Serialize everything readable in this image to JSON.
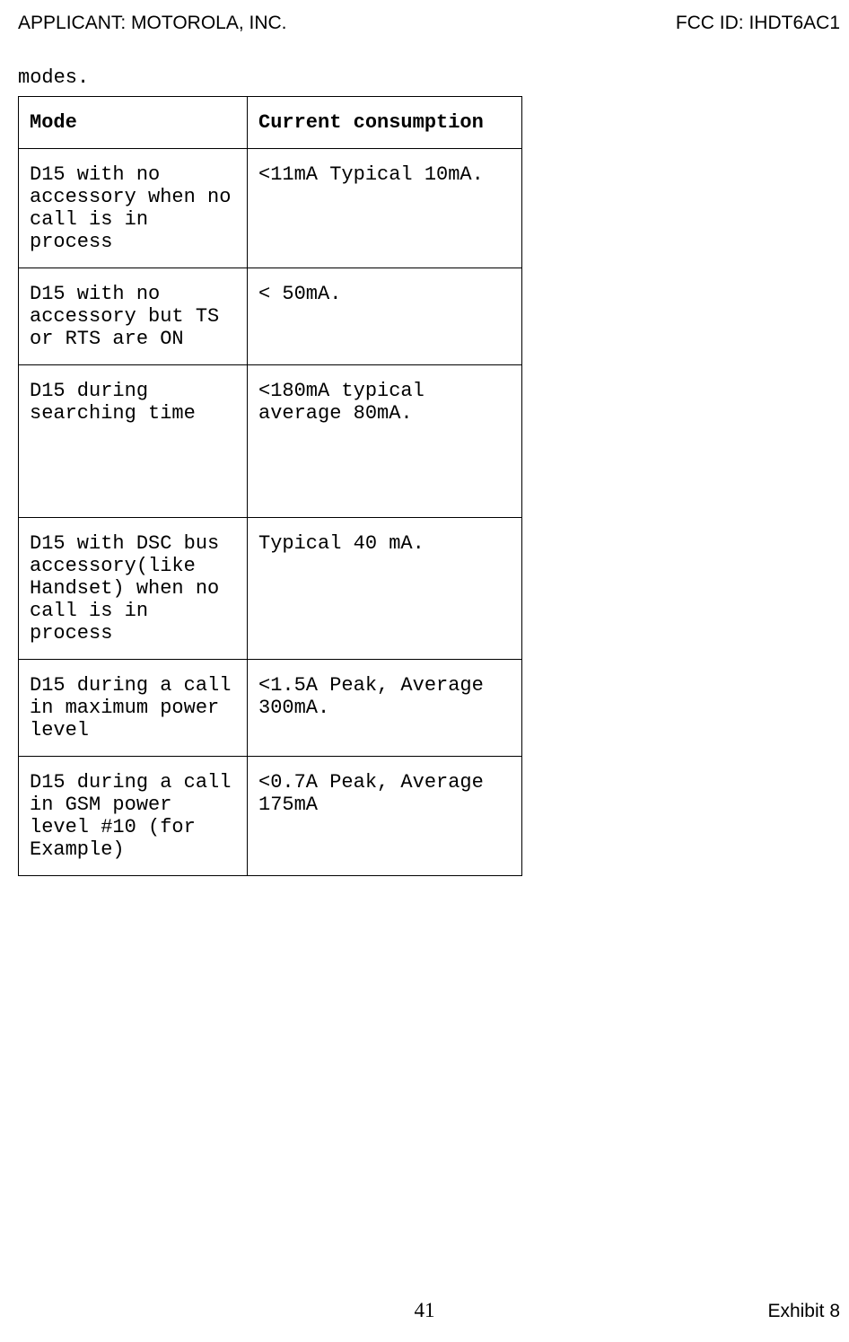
{
  "header": {
    "applicant_label": "APPLICANT:  MOTOROLA, INC.",
    "fcc_id": "FCC ID: IHDT6AC1"
  },
  "modes_caption": "modes.",
  "table": {
    "headers": {
      "mode": "Mode",
      "consumption": "Current consumption"
    },
    "rows": [
      {
        "mode": "D15 with no accessory  when no call is in process",
        "consumption": "<11mA Typical 10mA."
      },
      {
        "mode": "D15 with no accessory but TS or RTS are ON",
        "consumption": "< 50mA."
      },
      {
        "mode": "D15 during searching time",
        "consumption": "<180mA typical average 80mA."
      },
      {
        "mode": "D15 with DSC bus accessory(like Handset) when no call is in process",
        "consumption": "Typical 40 mA."
      },
      {
        "mode": "D15 during a call in maximum power level",
        "consumption": "<1.5A Peak, Average 300mA."
      },
      {
        "mode": "D15 during a call in GSM power level #10 (for Example)",
        "consumption": "<0.7A Peak, Average 175mA"
      }
    ]
  },
  "footer": {
    "page_number": "41",
    "exhibit": "Exhibit 8"
  }
}
